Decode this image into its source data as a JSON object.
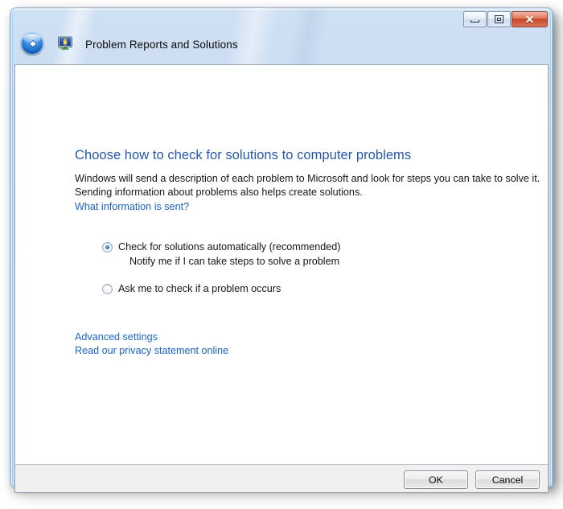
{
  "window": {
    "title": "Problem Reports and Solutions",
    "back_tooltip": "Back",
    "app_icon": "problem-reports-monitor-icon",
    "caption": {
      "minimize_label": "Minimize",
      "maximize_label": "Maximize",
      "close_glyph": "✕",
      "close_label": "Close"
    },
    "accent_color": "#2558a8",
    "titlebar_color": "#c6d9f1",
    "close_button_color": "#c4472a"
  },
  "content": {
    "heading": "Choose how to check for solutions to computer problems",
    "body_line_1": "Windows will send a description of each problem to Microsoft and look for steps you can take to solve it.",
    "body_line_2": "Sending information about problems also helps create solutions.",
    "info_link": "What information is sent?",
    "options": [
      {
        "label": "Check for solutions automatically (recommended)",
        "sub_label": "Notify me if I can take steps to solve a problem",
        "checked": true
      },
      {
        "label": "Ask me to check if a problem occurs",
        "sub_label": "",
        "checked": false
      }
    ],
    "links": [
      "Advanced settings",
      "Read our privacy statement online"
    ]
  },
  "footer": {
    "ok_label": "OK",
    "cancel_label": "Cancel"
  }
}
